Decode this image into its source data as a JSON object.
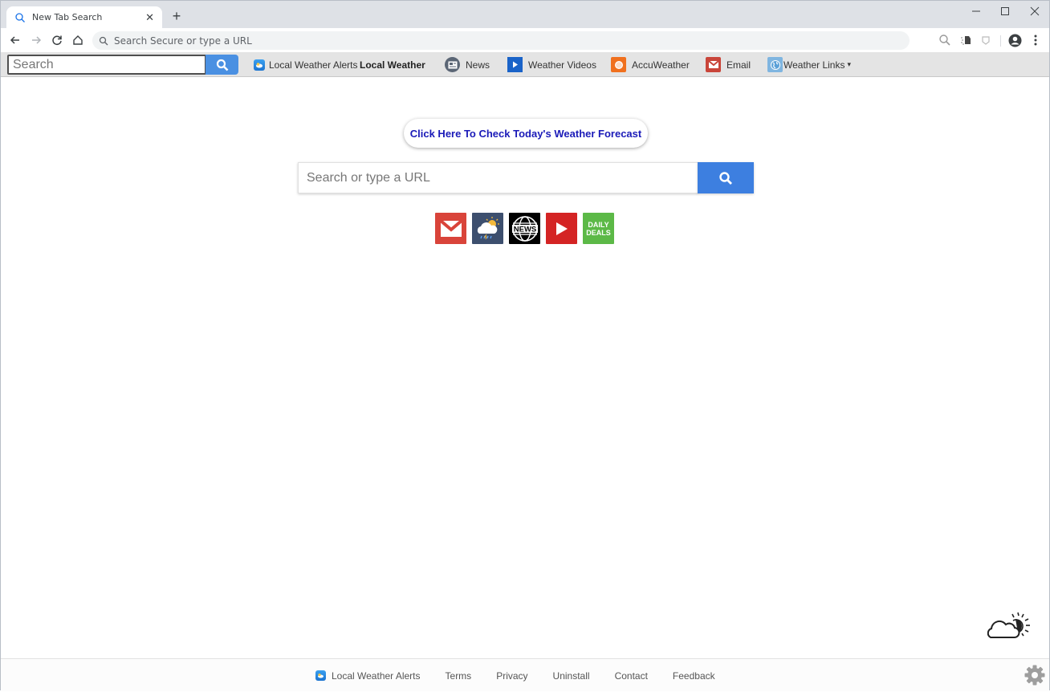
{
  "browser": {
    "tab": {
      "title": "New Tab Search",
      "close_glyph": "✕"
    },
    "new_tab_glyph": "+",
    "window_controls": {
      "minimize": "—",
      "maximize": "☐",
      "close": "✕"
    },
    "omnibox": {
      "placeholder": "Search Secure or type a URL"
    }
  },
  "toolbar": {
    "search_placeholder": "Search",
    "items": [
      {
        "label": "Local Weather Alerts",
        "icon": "weather-app-icon"
      },
      {
        "label": "Local Weather",
        "icon": ""
      },
      {
        "label": "News",
        "icon": "news-icon"
      },
      {
        "label": "Weather Videos",
        "icon": "play-icon"
      },
      {
        "label": "AccuWeather",
        "icon": "sun-icon"
      },
      {
        "label": "Email",
        "icon": "mail-icon"
      },
      {
        "label": "Weather Links",
        "icon": "globe-icon",
        "dropdown": "▾"
      }
    ]
  },
  "main": {
    "forecast_button": "Click Here To Check Today's Weather Forecast",
    "search_placeholder": "Search or type a URL",
    "tiles": [
      {
        "name": "gmail",
        "color": "#d9443a"
      },
      {
        "name": "weather",
        "color": "#3d4f6e"
      },
      {
        "name": "news",
        "color": "#000000"
      },
      {
        "name": "youtube",
        "color": "#d42424"
      },
      {
        "name": "daily-deals",
        "label_line1": "DAILY",
        "label_line2": "DEALS",
        "color": "#5cb947"
      }
    ]
  },
  "footer": {
    "links": [
      "Local Weather Alerts",
      "Terms",
      "Privacy",
      "Uninstall",
      "Contact",
      "Feedback"
    ]
  },
  "colors": {
    "accent_blue": "#3d7fe0",
    "forecast_text": "#1a1ab8",
    "toolbar_bg": "#e4e4e4"
  }
}
